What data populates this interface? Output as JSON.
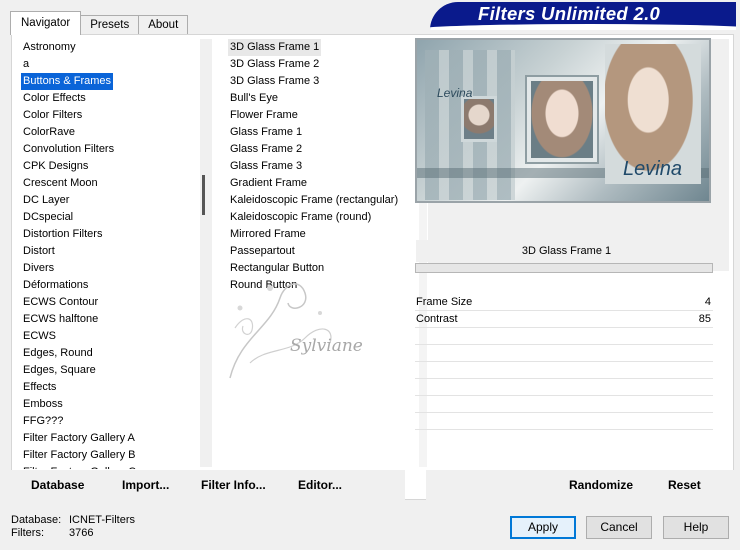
{
  "window": {
    "title": "Filters Unlimited 2.0"
  },
  "tabs": [
    {
      "label": "Navigator",
      "active": true
    },
    {
      "label": "Presets",
      "active": false
    },
    {
      "label": "About",
      "active": false
    }
  ],
  "categories": [
    "Astronomy",
    "a",
    "Buttons & Frames",
    "Color Effects",
    "Color Filters",
    "ColorRave",
    "Convolution Filters",
    "CPK Designs",
    "Crescent Moon",
    "DC Layer",
    "DCspecial",
    "Distortion Filters",
    "Distort",
    "Divers",
    "Déformations",
    "ECWS Contour",
    "ECWS halftone",
    "ECWS",
    "Edges, Round",
    "Edges, Square",
    "Effects",
    "Emboss",
    "FFG???",
    "Filter Factory Gallery A",
    "Filter Factory Gallery B",
    "Filter Factory Gallery C"
  ],
  "selected_category": "Buttons & Frames",
  "filters": [
    {
      "label": "3D Glass Frame 1",
      "grip": false
    },
    {
      "label": "3D Glass Frame 2",
      "grip": false
    },
    {
      "label": "3D Glass Frame 3",
      "grip": false
    },
    {
      "label": "Bull's Eye",
      "grip": false
    },
    {
      "label": "Flower Frame",
      "grip": true
    },
    {
      "label": "Glass Frame 1",
      "grip": false
    },
    {
      "label": "Glass Frame 2",
      "grip": false
    },
    {
      "label": "Glass Frame 3",
      "grip": false
    },
    {
      "label": "Gradient Frame",
      "grip": true
    },
    {
      "label": "Kaleidoscopic Frame (rectangular)",
      "grip": false
    },
    {
      "label": "Kaleidoscopic Frame (round)",
      "grip": false
    },
    {
      "label": "Mirrored Frame",
      "grip": false
    },
    {
      "label": "Passepartout",
      "grip": true
    },
    {
      "label": "Rectangular Button",
      "grip": false
    },
    {
      "label": "Round Button",
      "grip": false
    }
  ],
  "selected_filter": "3D Glass Frame 1",
  "preview": {
    "filter_name": "3D Glass Frame 1",
    "image_text_small": "Levina",
    "image_text_large": "Levina",
    "watermark": "Sylviane"
  },
  "parameters": [
    {
      "name": "Frame Size",
      "value": "4"
    },
    {
      "name": "Contrast",
      "value": "85"
    },
    {
      "name": "",
      "value": ""
    },
    {
      "name": "",
      "value": ""
    },
    {
      "name": "",
      "value": ""
    },
    {
      "name": "",
      "value": ""
    },
    {
      "name": "",
      "value": ""
    },
    {
      "name": "",
      "value": ""
    }
  ],
  "toolbar": {
    "database": "Database",
    "import": "Import...",
    "filter_info": "Filter Info...",
    "editor": "Editor...",
    "randomize": "Randomize",
    "reset": "Reset"
  },
  "status": {
    "database_label": "Database:",
    "database_value": "ICNET-Filters",
    "filters_label": "Filters:",
    "filters_value": "3766"
  },
  "buttons": {
    "apply": "Apply",
    "cancel": "Cancel",
    "help": "Help"
  },
  "colors": {
    "banner": "#0a1a8c",
    "selection": "#0a64d8",
    "default_button_border": "#0078d7"
  }
}
